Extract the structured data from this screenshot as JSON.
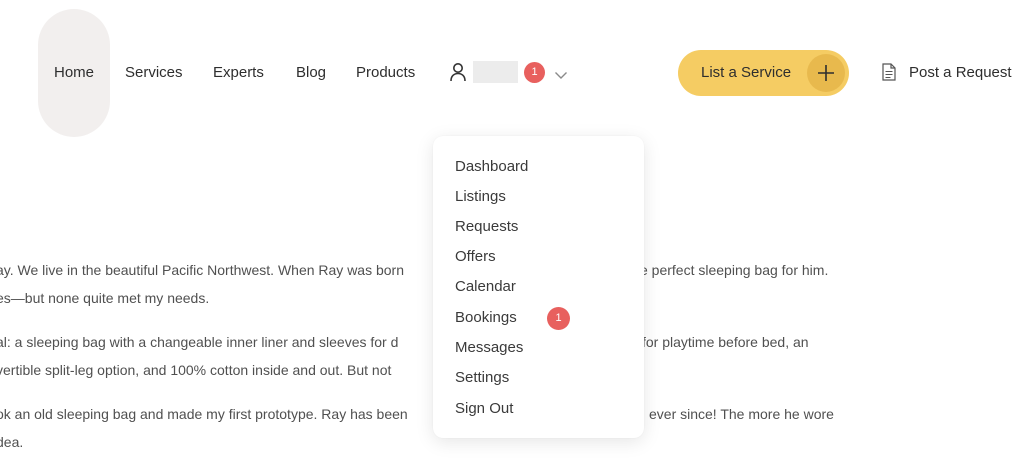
{
  "header": {
    "nav": [
      {
        "label": "Home"
      },
      {
        "label": "Services"
      },
      {
        "label": "Experts"
      },
      {
        "label": "Blog"
      },
      {
        "label": "Products"
      }
    ],
    "user_badge_count": "1",
    "list_service_label": "List a Service",
    "post_request_label": "Post a Request"
  },
  "user_menu": {
    "items": [
      {
        "label": "Dashboard"
      },
      {
        "label": "Listings"
      },
      {
        "label": "Requests"
      },
      {
        "label": "Offers"
      },
      {
        "label": "Calendar"
      },
      {
        "label": "Bookings",
        "badge": "1"
      },
      {
        "label": "Messages"
      },
      {
        "label": "Settings"
      },
      {
        "label": "Sign Out"
      }
    ]
  },
  "story": {
    "lines": [
      {
        "left": "ay. We live in the beautiful Pacific Northwest. When Ray was born",
        "right": "e perfect sleeping bag for him."
      },
      {
        "left": "es—but none quite met my needs.",
        "right": ""
      },
      {
        "left": "al: a sleeping bag with a changeable inner liner and sleeves for d",
        "right": "for playtime before bed, an"
      },
      {
        "left": "vertible split-leg option, and 100% cotton inside and out. But not",
        "right": ""
      },
      {
        "left": "ok an old sleeping bag and made my first prototype. Ray has been",
        "right": "ever since! The more he wore"
      },
      {
        "left": "dea.",
        "right": ""
      }
    ]
  },
  "colors": {
    "accent": "#f5cc63",
    "badge": "#e8605e",
    "pill": "#f2efee"
  }
}
